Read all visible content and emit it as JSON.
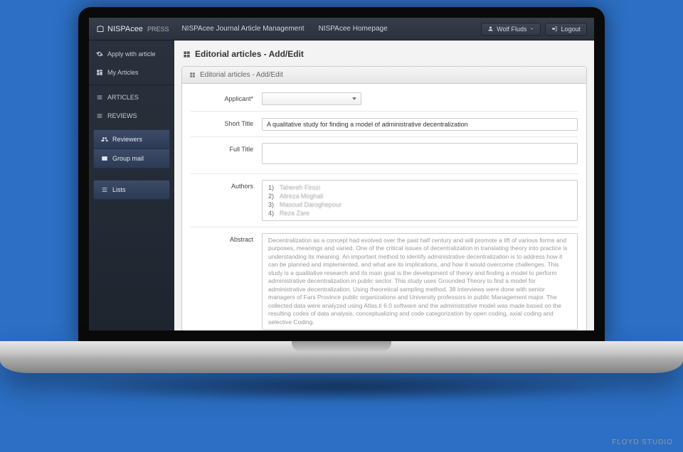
{
  "watermark": "FLOYD STUDIO",
  "brand": {
    "main": "NISPAcee",
    "sub": "PRESS"
  },
  "topnav": {
    "link1": "NISPAcee Journal Article Management",
    "link2": "NISPAcee Homepage"
  },
  "user": {
    "name": "Wolf Fluds",
    "logout": "Logout"
  },
  "sidebar": {
    "apply": "Apply with article",
    "my_articles": "My Articles",
    "articles": "ARTICLES",
    "reviews": "REVIEWS",
    "reviewers": "Reviewers",
    "group_mail": "Group mail",
    "lists": "Lists"
  },
  "page": {
    "title": "Editorial articles - Add/Edit",
    "panel_title": "Editorial articles - Add/Edit"
  },
  "form": {
    "applicant_label": "Applicant*",
    "short_title_label": "Short Title",
    "short_title_value": "A qualitative study for finding a model of administrative decentralization",
    "full_title_label": "Full Title",
    "full_title_value": "",
    "authors_label": "Authors",
    "authors": [
      {
        "num": "1)",
        "name": "Tahereh Firozi"
      },
      {
        "num": "2)",
        "name": "Alireza Moghali"
      },
      {
        "num": "3)",
        "name": "Masoud Daroghepour"
      },
      {
        "num": "4)",
        "name": "Reza Zare"
      }
    ],
    "abstract_label": "Abstract",
    "abstract_value": "Decentralization as a concept had evolved over the past half century and will promote a lift of various forms and purposes, meanings and varied. One of the critical issues of decentralization in translating theory into practice is understanding its meaning. An important method to identify administrative decentralization is to address how it can be planned and implemented, and what are its implications, and how it would overcome challenges. This study is a qualitative research and its main goal is the development of theory and finding a model to perform administrative decentralization in public sector. This study uses Grounded Theory to find a model for administrative decentralization. Using theoretical sampling method, 38 interviews were done with senior managers of Fars Province public organizations and University professors in public Management major. The collected data were analyzed using Atlas.ti 6.0 software and the administrative model was made based on the resulting codes of data analysis, conceptualizing and code categorization by open coding, axial coding and selective Coding."
  }
}
